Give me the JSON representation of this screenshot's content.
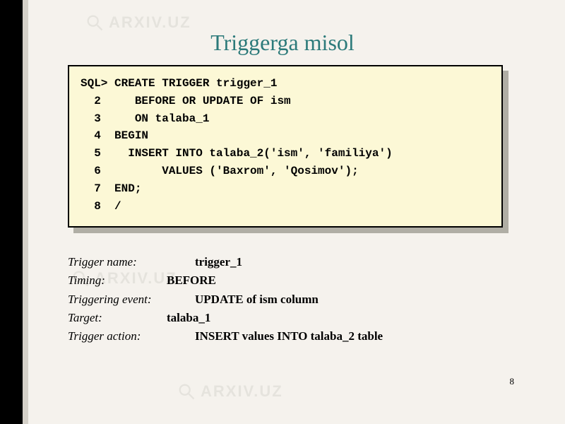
{
  "title": "Triggerga misol",
  "code": {
    "l1": "SQL> CREATE TRIGGER trigger_1",
    "l2": "  2     BEFORE OR UPDATE OF ism",
    "l3": "  3     ON talaba_1",
    "l4": "  4  BEGIN",
    "l5": "  5    INSERT INTO talaba_2('ism', 'familiya')",
    "l6": "  6         VALUES ('Baxrom', 'Qosimov');",
    "l7": "  7  END;",
    "l8": "  8  /"
  },
  "details": {
    "trigger_name_label": "Trigger name:",
    "trigger_name_value": "trigger_1",
    "timing_label": "Timing:",
    "timing_value": "BEFORE",
    "event_label": "Triggering event:",
    "event_value": "UPDATE of ism column",
    "target_label": "Target:",
    "target_value": "talaba_1",
    "action_label": "Trigger action:",
    "action_value": "INSERT values INTO talaba_2 table"
  },
  "watermark": {
    "text": "ARXIV.UZ"
  },
  "page_number": "8"
}
